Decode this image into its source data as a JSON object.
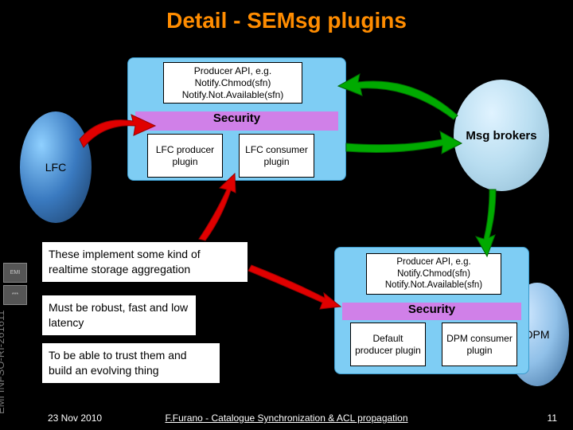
{
  "title": "Detail - SEMsg plugins",
  "sidebar": {
    "label": "EMI INFSO-RI-261611"
  },
  "footer": {
    "left": "23 Nov 2010",
    "center": "F.Furano - Catalogue Synchronization & ACL propagation",
    "right": "11"
  },
  "nodes": {
    "lfc": "LFC",
    "msg": "Msg brokers",
    "dpm": "DPM"
  },
  "group1": {
    "api": "Producer API, e.g.\nNotify.Chmod(sfn)\nNotify.Not.Available(sfn)",
    "security": "Security",
    "plugin_a": "LFC\nproducer\nplugin",
    "plugin_b": "LFC\nconsumer\nplugin"
  },
  "group2": {
    "api": "Producer API, e.g.\nNotify.Chmod(sfn)\nNotify.Not.Available(sfn)",
    "security": "Security",
    "plugin_a": "Default\nproducer\nplugin",
    "plugin_b": "DPM\nconsumer\nplugin"
  },
  "notes": {
    "n1": "These implement some kind of realtime storage aggregation",
    "n2": "Must be robust, fast and low latency",
    "n3": "To be able to trust them and build an evolving thing"
  }
}
